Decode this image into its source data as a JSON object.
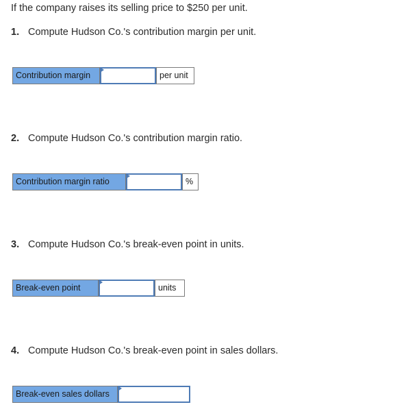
{
  "intro": "If the company raises its selling price to $250 per unit.",
  "questions": [
    {
      "number": "1.",
      "text": "Compute Hudson Co.'s contribution margin per unit.",
      "field_label": "Contribution margin",
      "value": "",
      "unit": "per unit"
    },
    {
      "number": "2.",
      "text": "Compute Hudson Co.'s contribution margin ratio.",
      "field_label": "Contribution margin ratio",
      "value": "",
      "unit": "%"
    },
    {
      "number": "3.",
      "text": "Compute Hudson Co.'s break-even point in units.",
      "field_label": "Break-even point",
      "value": "",
      "unit": "units"
    },
    {
      "number": "4.",
      "text": "Compute Hudson Co.'s break-even point in sales dollars.",
      "field_label": "Break-even sales dollars",
      "value": ""
    }
  ]
}
